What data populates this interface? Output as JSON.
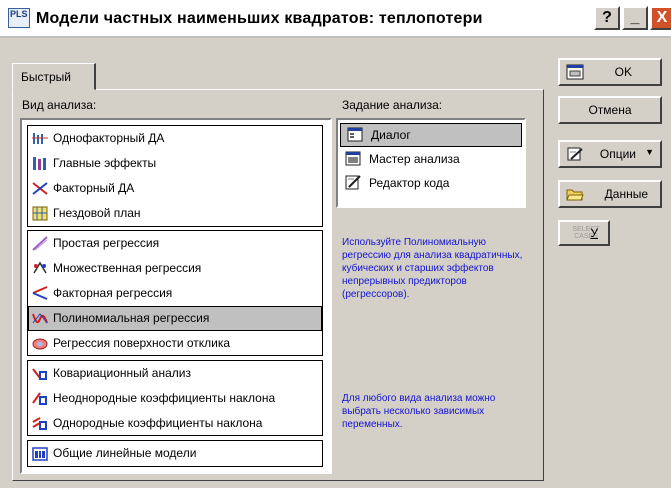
{
  "window": {
    "title": "Модели частных наименьших квадратов: теплопотери",
    "icon_text": "PLS"
  },
  "title_buttons": {
    "help": "?",
    "minimize": "_",
    "close": "X"
  },
  "tab": {
    "label": "Быстрый"
  },
  "analysis_type": {
    "label": "Вид анализа:",
    "groups": [
      [
        {
          "label": "Однофакторный ДА",
          "icon": "oneway-anova-icon"
        },
        {
          "label": "Главные эффекты",
          "icon": "main-effects-icon"
        },
        {
          "label": "Факторный ДА",
          "icon": "factorial-anova-icon"
        },
        {
          "label": "Гнездовой план",
          "icon": "nested-design-icon"
        }
      ],
      [
        {
          "label": "Простая регрессия",
          "icon": "simple-regression-icon"
        },
        {
          "label": "Множественная регрессия",
          "icon": "multiple-regression-icon"
        },
        {
          "label": "Факторная регрессия",
          "icon": "factorial-regression-icon"
        },
        {
          "label": "Полиномиальная регрессия",
          "icon": "polynomial-regression-icon",
          "selected": true
        },
        {
          "label": "Регрессия поверхности отклика",
          "icon": "response-surface-icon"
        }
      ],
      [
        {
          "label": "Ковариационный анализ",
          "icon": "ancova-icon"
        },
        {
          "label": "Неоднородные коэффициенты наклона",
          "icon": "separate-slopes-icon"
        },
        {
          "label": "Однородные коэффициенты наклона",
          "icon": "homogeneous-slopes-icon"
        }
      ],
      [
        {
          "label": "Общие линейные модели",
          "icon": "glm-icon"
        }
      ]
    ]
  },
  "analysis_task": {
    "label": "Задание анализа:",
    "items": [
      {
        "label": "Диалог",
        "icon": "dialog-icon",
        "selected": true
      },
      {
        "label": "Мастер анализа",
        "icon": "wizard-icon"
      },
      {
        "label": "Редактор кода",
        "icon": "code-editor-icon"
      }
    ]
  },
  "help_text": {
    "polynomial": "Используйте Полиномиальную регрессию для анализа квадратичных, кубических и старших эффектов непрерывных предикторов (регрессоров).",
    "dependent": "Для любого вида анализа можно выбрать несколько зависимых переменных."
  },
  "buttons": {
    "ok": "OK",
    "cancel": "Отмена",
    "options": "Опции",
    "options_arrow": "▼",
    "data": "Данные",
    "select_cases_small": "SELECT CASES",
    "select_cases_letter": "У"
  },
  "colors": {
    "face": "#d4d0c8",
    "help_text": "#1414d4",
    "close_button": "#d0522a"
  }
}
